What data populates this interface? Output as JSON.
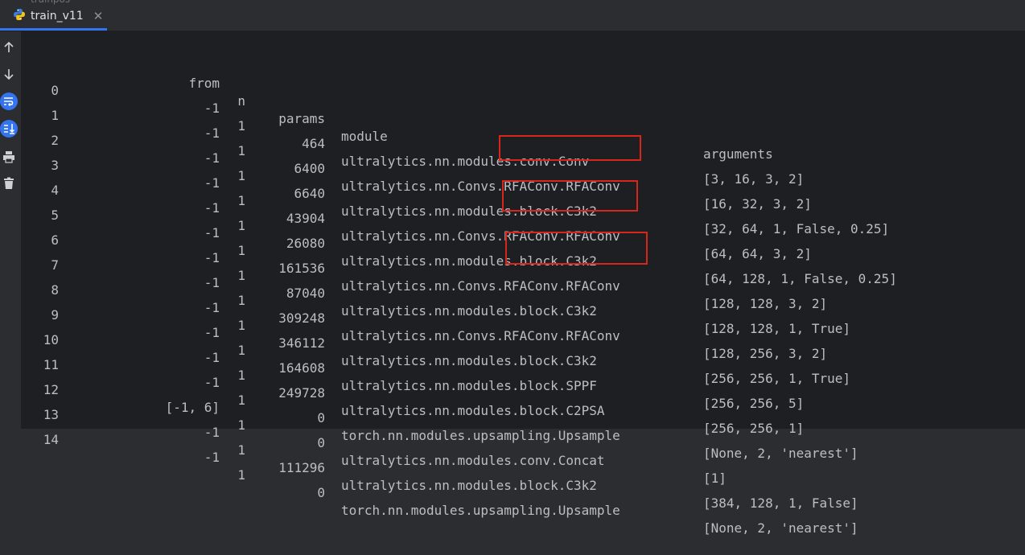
{
  "window": {
    "ghost_tab_label": "trainpos",
    "tab_label": "train_v11",
    "tab_close": "✕"
  },
  "toolbar": {
    "icons": [
      "up-arrow-icon",
      "down-arrow-icon",
      "soft-wrap-icon",
      "scroll-to-end-icon",
      "print-icon",
      "trash-icon"
    ]
  },
  "table": {
    "headers": {
      "idx": "",
      "from": "from",
      "n": "n",
      "params": "params",
      "module": "module",
      "arguments": "arguments"
    },
    "rows": [
      {
        "idx": "0",
        "from": "-1",
        "n": "1",
        "params": "464",
        "module": "ultralytics.nn.modules.conv.Conv",
        "arguments": "[3, 16, 3, 2]"
      },
      {
        "idx": "1",
        "from": "-1",
        "n": "1",
        "params": "6400",
        "module": "ultralytics.nn.Convs.RFAConv.RFAConv",
        "arguments": "[16, 32, 3, 2]"
      },
      {
        "idx": "2",
        "from": "-1",
        "n": "1",
        "params": "6640",
        "module": "ultralytics.nn.modules.block.C3k2",
        "arguments": "[32, 64, 1, False, 0.25]"
      },
      {
        "idx": "3",
        "from": "-1",
        "n": "1",
        "params": "43904",
        "module": "ultralytics.nn.Convs.RFAConv.RFAConv",
        "arguments": "[64, 64, 3, 2]"
      },
      {
        "idx": "4",
        "from": "-1",
        "n": "1",
        "params": "26080",
        "module": "ultralytics.nn.modules.block.C3k2",
        "arguments": "[64, 128, 1, False, 0.25]"
      },
      {
        "idx": "5",
        "from": "-1",
        "n": "1",
        "params": "161536",
        "module": "ultralytics.nn.Convs.RFAConv.RFAConv",
        "arguments": "[128, 128, 3, 2]"
      },
      {
        "idx": "6",
        "from": "-1",
        "n": "1",
        "params": "87040",
        "module": "ultralytics.nn.modules.block.C3k2",
        "arguments": "[128, 128, 1, True]"
      },
      {
        "idx": "7",
        "from": "-1",
        "n": "1",
        "params": "309248",
        "module": "ultralytics.nn.Convs.RFAConv.RFAConv",
        "arguments": "[128, 256, 3, 2]"
      },
      {
        "idx": "8",
        "from": "-1",
        "n": "1",
        "params": "346112",
        "module": "ultralytics.nn.modules.block.C3k2",
        "arguments": "[256, 256, 1, True]"
      },
      {
        "idx": "9",
        "from": "-1",
        "n": "1",
        "params": "164608",
        "module": "ultralytics.nn.modules.block.SPPF",
        "arguments": "[256, 256, 5]"
      },
      {
        "idx": "10",
        "from": "-1",
        "n": "1",
        "params": "249728",
        "module": "ultralytics.nn.modules.block.C2PSA",
        "arguments": "[256, 256, 1]"
      },
      {
        "idx": "11",
        "from": "-1",
        "n": "1",
        "params": "0",
        "module": "torch.nn.modules.upsampling.Upsample",
        "arguments": "[None, 2, 'nearest']"
      },
      {
        "idx": "12",
        "from": "[-1, 6]",
        "n": "1",
        "params": "0",
        "module": "ultralytics.nn.modules.conv.Concat",
        "arguments": "[1]"
      },
      {
        "idx": "13",
        "from": "-1",
        "n": "1",
        "params": "111296",
        "module": "ultralytics.nn.modules.block.C3k2",
        "arguments": "[384, 128, 1, False]"
      },
      {
        "idx": "14",
        "from": "-1",
        "n": "1",
        "params": "0",
        "module": "torch.nn.modules.upsampling.Upsample",
        "arguments": "[None, 2, 'nearest']"
      }
    ]
  },
  "colors": {
    "highlight_box": "#d9261c",
    "tab_underline": "#3574f0",
    "toolbar_icon_active": "#3574f0"
  }
}
